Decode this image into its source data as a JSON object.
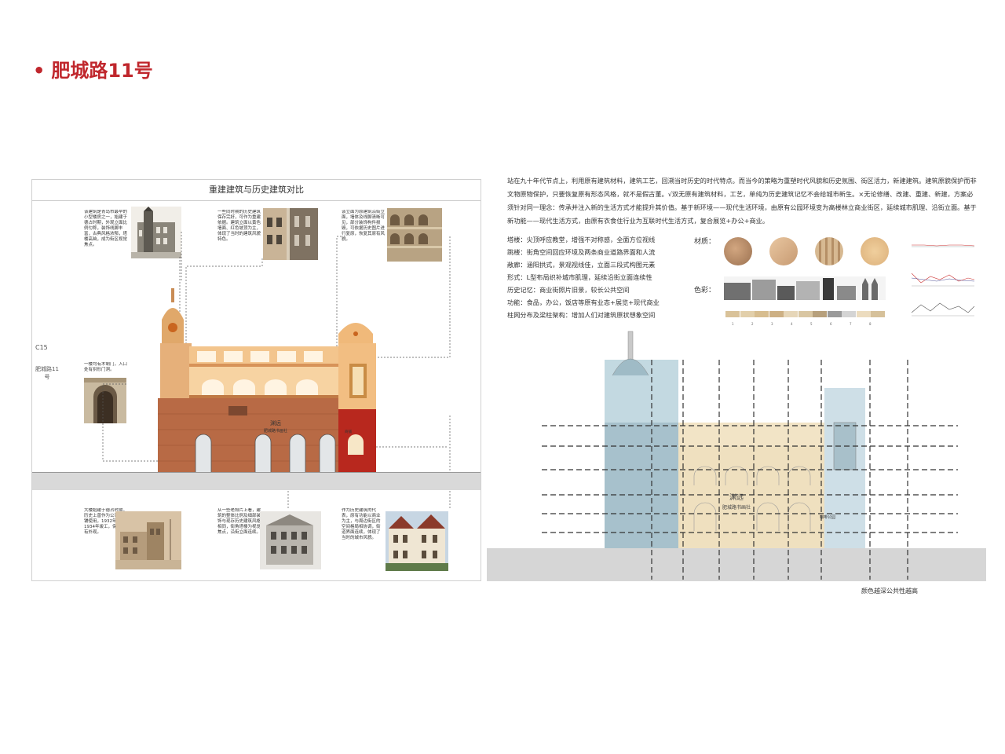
{
  "title": "肥城路11号",
  "left_panel": {
    "header": "重建建筑与历史建筑对比",
    "side_code": "C15",
    "side_name": "肥城路11号",
    "notes": [
      "该建筑是青岛市最早的小型楼房之一，始建于德占时期，外观立面比例匀称，装饰线脚丰富，古典风格浓郁，塔楼高耸，成为街区视觉焦点。",
      "一些同时期的历史建筑保存完好，可作为重建依据。建筑立面以黄色墙面、红色坡顶为主，体现了当时的建筑风貌特色。",
      "该立面为原建筑沿街立面，墙体及线脚清晰可见，部分装饰构件损毁，可依据历史图片进行复原，恢复其原有风貌。",
      "一楼均有木制门，入口处有拱形门洞。",
      "大楼始建于德占时期，历史上曾作为公司、商铺使用，1932年改建，1934年竣工，保留了原有外观。",
      "从一些老照片上看，建筑的整体比例及细部装饰与现存历史建筑风格相同，街角塔楼为视觉焦点，沿街立面连续。",
      "作为历史建筑的代表，原有功能以商业为主，与周边街区的空间格局相协调，街道界面连续，体现了当时的城市风貌。"
    ],
    "sign_main": "渊远",
    "sign_sub": "肥城路书画社",
    "shop_label": "商铺"
  },
  "right_panel": {
    "intro": "站在九十年代节点上，利用原有建筑材料，建筑工艺，回溯当时历史的时代特点。而当今的策略为重塑时代风貌和历史氛围、街区活力，新建建筑。建筑原貌保护而非文物原物保护，只要恢复原有形态风格，就不是假古董。√双无原有建筑材料，工艺，单纯为历史建筑记忆不会给城市新生。×无论修缮、改建、重建、新建，方案必须针对同一理念：传承并注入新的生活方式才能提升其价值。基于新环境——现代生活环境，由原有公园环境变为高楼林立商业街区，延续城市肌理、沿街立面。基于新功能——现代生活方式，由原有衣食住行业为互联时代生活方式，复合展览+办公+商业。",
    "list": [
      "塔楼：尖顶呼应教堂，增强不对称感，全面方位视线",
      "跳楼：街角空间回应环境及两条商业道路界面和人流",
      "敞廊：涵阳拱式，景观视线佳，立面三段式构图元素",
      "形式：L型布局织补城市肌理，延续沿街立面连续性",
      "历史记忆：商业街照片旧景，较长公共空间",
      "功能：食品，办公，饭店等原有业态+展览+现代商业",
      "柱网分布及梁柱架构：增加人们对建筑原状想象空间"
    ],
    "material_label": "材质：",
    "color_label": "色彩：",
    "swatch_colors": [
      "#d9c299",
      "#e2cfaa",
      "#d7bd8f",
      "#cdb084",
      "#e6d6b8",
      "#d9c6a2",
      "#b7a07c",
      "#9a9a9a",
      "#d4d4d4",
      "#ecdcbf",
      "#d6c19a"
    ],
    "swatch_nums": [
      "1",
      "2",
      "3",
      "4",
      "5",
      "6",
      "7",
      "8"
    ],
    "sign_main": "渊远",
    "sign_sub": "肥城路书画社",
    "side_label": "咖啡公园",
    "caption": "颜色越深公共性越高"
  }
}
